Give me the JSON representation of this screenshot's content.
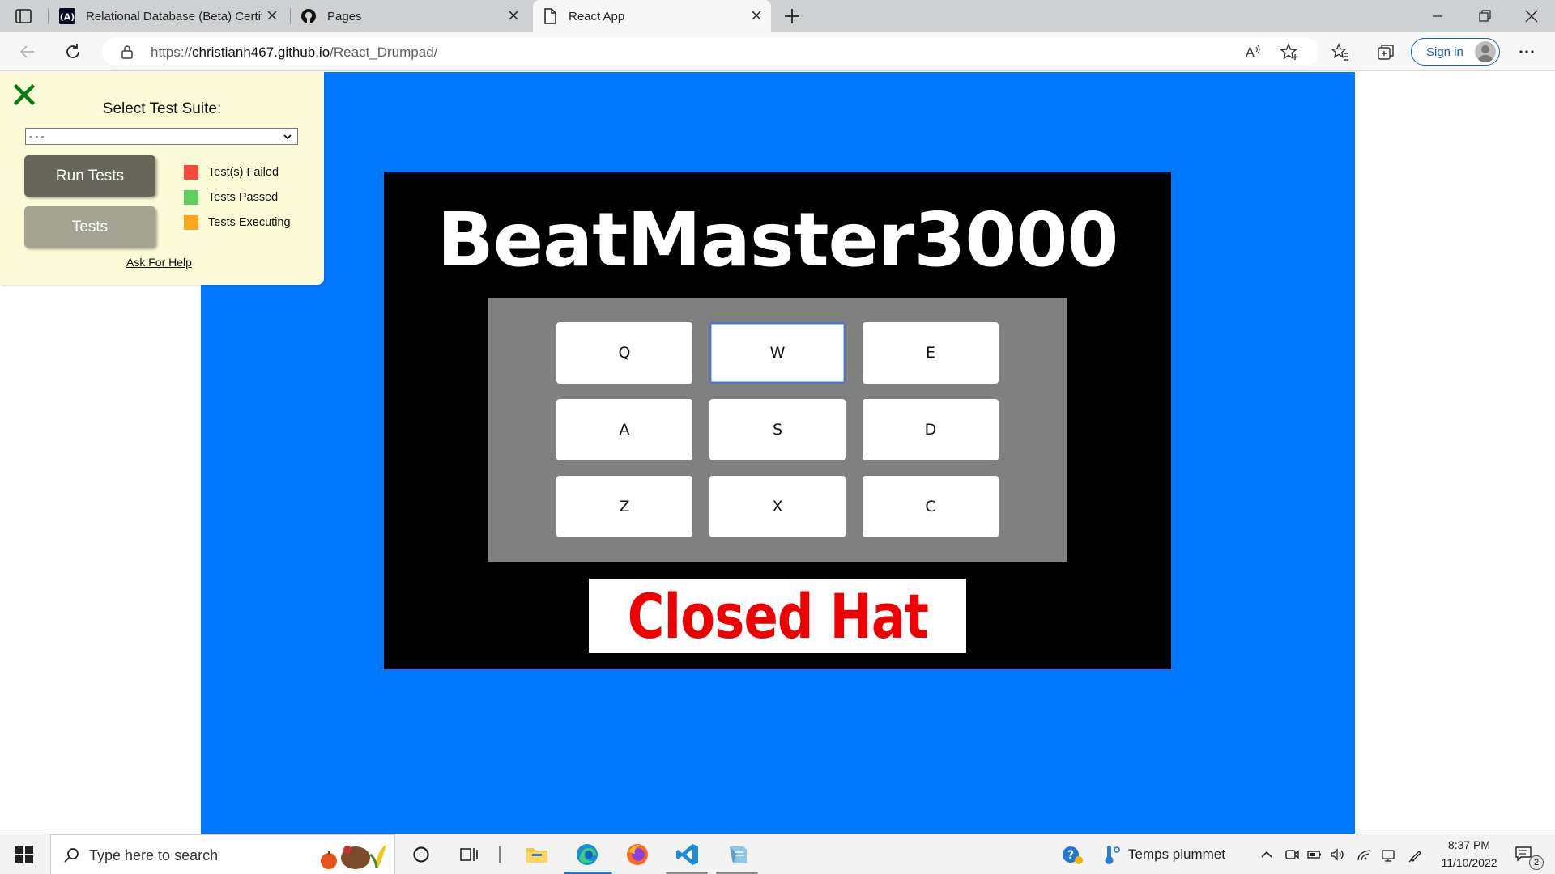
{
  "browser": {
    "tabs": [
      {
        "title": "Relational Database (Beta) Certifi",
        "icon": "freecodecamp-icon",
        "active": false
      },
      {
        "title": "Pages",
        "icon": "github-icon",
        "active": false
      },
      {
        "title": "React App",
        "icon": "page-icon",
        "active": true
      }
    ],
    "url_prefix": "https://",
    "url_domain": "christianh467.github.io",
    "url_path": "/React_Drumpad/",
    "sign_in_label": "Sign in"
  },
  "test_panel": {
    "suite_label": "Select Test Suite:",
    "suite_selected": "- - -",
    "run_tests_label": "Run Tests",
    "tests_label": "Tests",
    "legend": [
      {
        "label": "Test(s) Failed",
        "color": "#f54a3c"
      },
      {
        "label": "Tests Passed",
        "color": "#5ed05e"
      },
      {
        "label": "Tests Executing",
        "color": "#ffa51c"
      }
    ],
    "help_link": "Ask For Help"
  },
  "drum_machine": {
    "title": "BeatMaster3000",
    "pads": [
      {
        "key": "Q",
        "focused": false
      },
      {
        "key": "W",
        "focused": true
      },
      {
        "key": "E",
        "focused": false
      },
      {
        "key": "A",
        "focused": false
      },
      {
        "key": "S",
        "focused": false
      },
      {
        "key": "D",
        "focused": false
      },
      {
        "key": "Z",
        "focused": false
      },
      {
        "key": "X",
        "focused": false
      },
      {
        "key": "C",
        "focused": false
      }
    ],
    "display_text": "Closed Hat",
    "colors": {
      "background": "#0077ff",
      "machine": "#000000",
      "pad_bank": "#808080",
      "display_text": "#ee0000"
    }
  },
  "taskbar": {
    "search_placeholder": "Type here to search",
    "weather_text": "Temps plummet",
    "time": "8:37 PM",
    "date": "11/10/2022",
    "notification_count": "2",
    "apps": [
      "cortana-icon",
      "task-view-icon",
      "file-explorer-icon",
      "edge-icon",
      "firefox-icon",
      "vscode-icon",
      "notepad-icon"
    ]
  }
}
